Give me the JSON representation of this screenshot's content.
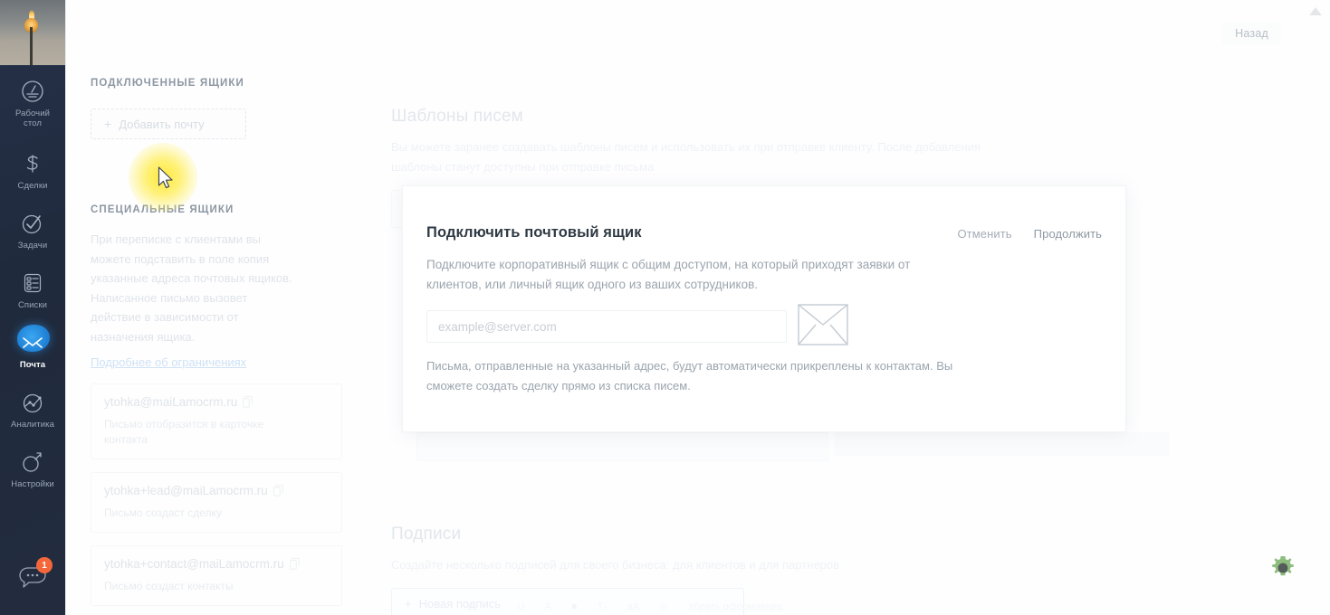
{
  "app": {
    "accent_blue": "#1e7fd4",
    "sidebar_bg": "#242f40",
    "badge_color": "#f4673b",
    "gear_color": "#8cbd7c"
  },
  "sidebar": {
    "avatar_name": "user-avatar-photo",
    "items": [
      {
        "label": "Рабочий\nстол",
        "icon": "dashboard-icon",
        "active": false
      },
      {
        "label": "Сделки",
        "icon": "deals-dollar-icon",
        "active": false
      },
      {
        "label": "Задачи",
        "icon": "tasks-check-icon",
        "active": false
      },
      {
        "label": "Списки",
        "icon": "lists-icon",
        "active": false
      },
      {
        "label": "Почта",
        "icon": "mail-icon",
        "active": true
      },
      {
        "label": "Аналитика",
        "icon": "analytics-icon",
        "active": false
      },
      {
        "label": "Настройки",
        "icon": "settings-wrench-icon",
        "active": false
      }
    ],
    "chat": {
      "icon": "chat-bubble-icon",
      "badge_count": "1"
    }
  },
  "header": {
    "back_label": "Назад"
  },
  "left_column": {
    "connected_heading": "ПОДКЛЮЧЕННЫЕ ЯЩИКИ",
    "add_mail_label": "Добавить почту",
    "add_mail_plus": "+",
    "special_heading": "СПЕЦИАЛЬНЫЕ ЯЩИКИ",
    "special_description": "При переписке с клиентами вы можете подставить в поле копия указанные адреса почтовых ящиков. Написанное письмо вызовет действие в зависимости от назначения ящика.",
    "limits_link": "Подробнее об ограничениях",
    "mailboxes": [
      {
        "address": "ytohka@maiLamocrm.ru",
        "hint": "Письмо отобразится в карточке контакта"
      },
      {
        "address": "ytohka+lead@maiLamocrm.ru",
        "hint": "Письмо создаст сделку"
      },
      {
        "address": "ytohka+contact@maiLamocrm.ru",
        "hint": "Письмо создаст контакты"
      }
    ]
  },
  "main": {
    "templates": {
      "title": "Шаблоны писем",
      "description": "Вы можете заранее создавать шаблоны писем и использовать их при отправке клиенту. После добавления шаблоны станут доступны при отправке письма"
    },
    "signatures": {
      "title": "Подписи",
      "description": "Создайте несколько подписей для своего бизнеса: для клиентов и для партнеров",
      "new_signature_label": "Новая подпись",
      "new_signature_plus": "+",
      "toolbar_items": [
        "B",
        "I",
        "U",
        "A",
        "■",
        "T₀",
        "аА",
        "◎",
        "Убрать оформление"
      ]
    }
  },
  "modal": {
    "title": "Подключить почтовый ящик",
    "cancel_label": "Отменить",
    "continue_label": "Продолжить",
    "description": "Подключите корпоративный ящик с общим доступом, на который приходят заявки от клиентов, или личный ящик одного из ваших сотрудников.",
    "email_placeholder": "example@server.com",
    "email_value": "",
    "envelope_icon": "envelope-icon",
    "note": "Письма, отправленные на указанный адрес, будут автоматически прикреплены к контактам. Вы сможете создать сделку прямо из списка писем."
  },
  "overlays": {
    "cursor_highlight": "cursor-click-highlight",
    "gear_badge": "gear-icon",
    "scroll_up": "scroll-up-arrow-icon"
  }
}
